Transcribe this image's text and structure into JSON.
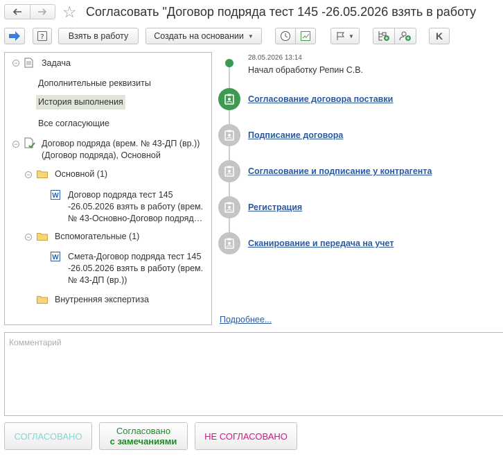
{
  "window": {
    "title": "Согласовать \"Договор подряда тест 145 -26.05.2026 взять в работу"
  },
  "toolbar": {
    "take_to_work": "Взять в работу",
    "create_based_on": "Создать на основании",
    "k_label": "K"
  },
  "tree": {
    "task": "Задача",
    "additional": "Дополнительные реквизиты",
    "history": "История выполнения",
    "approvers": "Все согласующие",
    "contract_line1": "Договор подряда (врем. № 43-ДП (вр.))",
    "contract_line2": "(Договор подряда), Основной",
    "main_folder": "Основной (1)",
    "main_doc_line1": "Договор подряда тест 145",
    "main_doc_line2": "-26.05.2026 взять в работу (врем.",
    "main_doc_line3": "№ 43-Основно-Договор подряд…",
    "aux_folder": "Вспомогательные (1)",
    "aux_doc_line1": "Смета-Договор подряда тест 145",
    "aux_doc_line2": "-26.05.2026 взять в работу (врем.",
    "aux_doc_line3": "№ 43-ДП (вр.))",
    "expert_folder": "Внутренняя экспертиза"
  },
  "timeline": {
    "start_date": "28.05.2026 13:14",
    "start_text": "Начал обработку Репин С.В.",
    "steps": [
      "Согласование договора поставки",
      "Подписание договора",
      "Согласование и подписание у контрагента",
      "Регистрация",
      "Сканирование и передача на учет"
    ],
    "more": "Подробнее..."
  },
  "comment": {
    "placeholder": "Комментарий"
  },
  "actions": {
    "approved": "СОГЛАСОВАНО",
    "approved_remarks_line1": "Согласовано",
    "approved_remarks_line2": "с замечаниями",
    "not_approved": "НЕ СОГЛАСОВАНО"
  },
  "colors": {
    "active_step": "#3d9a50",
    "pending_step": "#c4c4c4",
    "link": "#2c5aa0",
    "approved": "#7fd9d2",
    "approved_remarks": "#1e8a24",
    "not_approved": "#d4148c"
  }
}
